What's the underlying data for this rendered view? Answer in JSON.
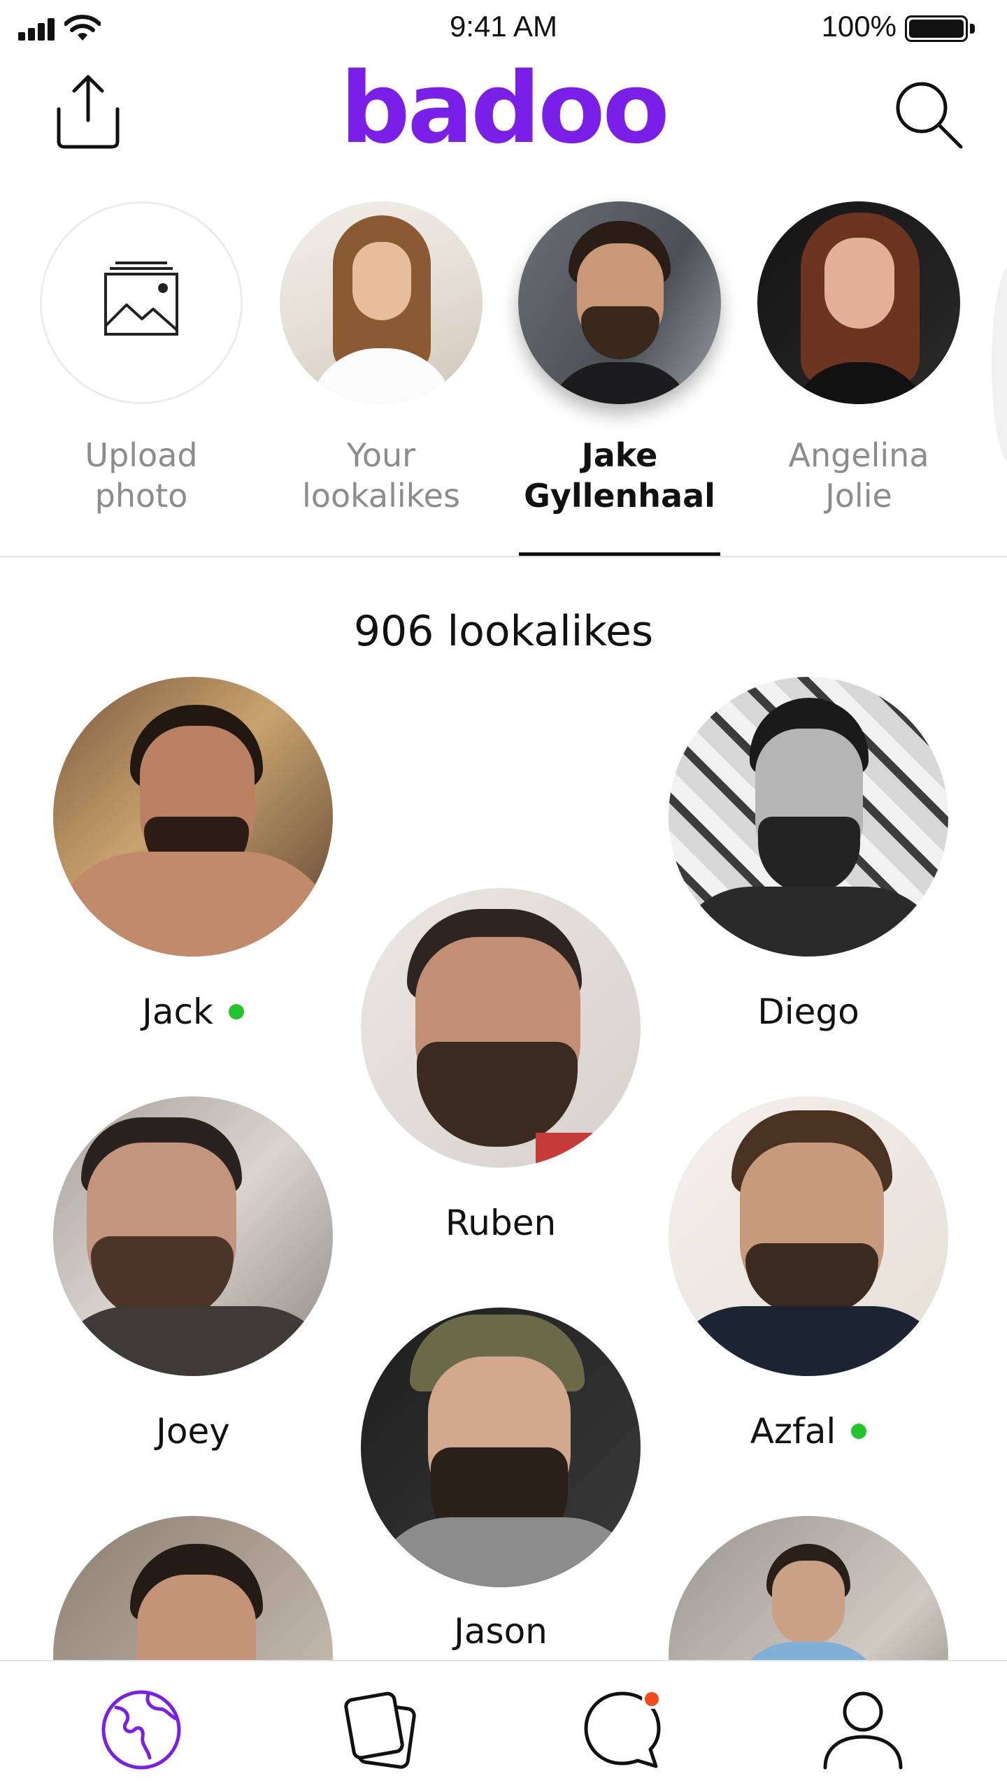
{
  "status_bar": {
    "time": "9:41 AM",
    "battery": "100%"
  },
  "header": {
    "logo": "badoo",
    "share_icon": "share-icon",
    "search_icon": "search-icon"
  },
  "celebrities": [
    {
      "label": "Upload photo",
      "line1": "Upload",
      "line2": "photo",
      "kind": "upload",
      "icon": "image-icon"
    },
    {
      "label": "Your lookalikes",
      "line1": "Your",
      "line2": "lookalikes",
      "kind": "photo"
    },
    {
      "label": "Jake Gyllenhaal",
      "line1": "Jake",
      "line2": "Gyllenhaal",
      "kind": "photo",
      "selected": true
    },
    {
      "label": "Angelina Jolie",
      "line1": "Angelina",
      "line2": "Jolie",
      "kind": "photo"
    }
  ],
  "lookalikes": {
    "count_label": "906 lookalikes",
    "people": [
      {
        "name": "Jack",
        "online": true
      },
      {
        "name": "Diego",
        "online": false
      },
      {
        "name": "Ruben",
        "online": false
      },
      {
        "name": "Joey",
        "online": false
      },
      {
        "name": "Azfal",
        "online": true
      },
      {
        "name": "Jason",
        "online": false
      }
    ]
  },
  "bottom_nav": [
    {
      "name": "people-nearby",
      "icon": "globe-icon",
      "active": true
    },
    {
      "name": "encounters",
      "icon": "cards-icon",
      "active": false
    },
    {
      "name": "messages",
      "icon": "chat-icon",
      "active": false,
      "badge": true
    },
    {
      "name": "profile",
      "icon": "person-icon",
      "active": false
    }
  ],
  "colors": {
    "brand": "#7a1fe8",
    "online": "#22c52b",
    "badge": "#f24a1d",
    "inactive_text": "#8c8c8c"
  }
}
